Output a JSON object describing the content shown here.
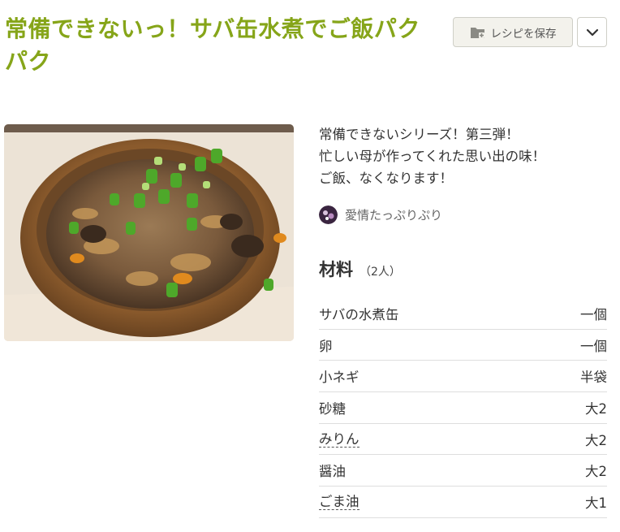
{
  "recipe": {
    "title": "常備できないっ！サバ缶水煮でご飯パクパク",
    "save_label": "レシピを保存",
    "description": [
      "常備できないシリーズ！第三弾！",
      "忙しい母が作ってくれた思い出の味！",
      "ご飯、なくなります！"
    ],
    "author": "愛情たっぷりぷり",
    "ingredients_heading": "材料",
    "servings": "（2人）",
    "ingredients": [
      {
        "name": "サバの水煮缶",
        "qty": "一個",
        "link": false
      },
      {
        "name": "卵",
        "qty": "一個",
        "link": false
      },
      {
        "name": "小ネギ",
        "qty": "半袋",
        "link": false
      },
      {
        "name": "砂糖",
        "qty": "大2",
        "link": false
      },
      {
        "name": "みりん",
        "qty": "大2",
        "link": true
      },
      {
        "name": "醤油",
        "qty": "大2",
        "link": false
      },
      {
        "name": "ごま油",
        "qty": "大1",
        "link": true
      }
    ]
  },
  "icons": {
    "save": "folder-plus-icon",
    "menu": "chevron-down-icon"
  },
  "colors": {
    "title": "#86a519",
    "button_bg": "#f3f2ec"
  }
}
